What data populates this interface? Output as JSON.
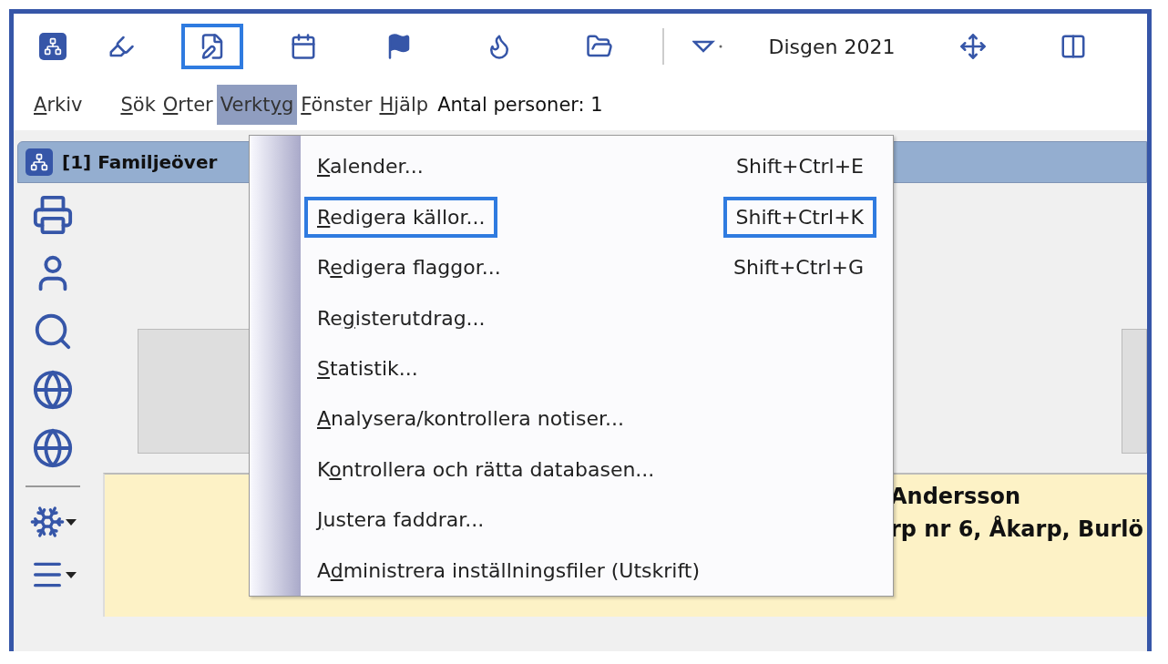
{
  "toolbar": {
    "items": [
      {
        "kind": "logo"
      },
      {
        "kind": "highlighter"
      },
      {
        "kind": "edit-document",
        "highlighted": true
      },
      {
        "kind": "calendar"
      },
      {
        "kind": "flag"
      },
      {
        "kind": "flame"
      },
      {
        "kind": "folder-person"
      },
      {
        "kind": "separator"
      },
      {
        "kind": "dropdown"
      },
      {
        "kind": "title",
        "text": "Disgen 2021"
      },
      {
        "kind": "move"
      },
      {
        "kind": "columns"
      }
    ]
  },
  "menubar": {
    "items": [
      {
        "key": "A",
        "after": "rkiv",
        "selected": false
      },
      {
        "key": "S",
        "after": "ök",
        "selected": false
      },
      {
        "key": "O",
        "after": "rter",
        "selected": false
      },
      {
        "before": "Verkt",
        "key": "y",
        "after": "g",
        "selected": true
      },
      {
        "key": "F",
        "after": "önster",
        "selected": false
      },
      {
        "key": "H",
        "after": "jälp",
        "selected": false
      }
    ],
    "status": "Antal personer: 1"
  },
  "tab": {
    "title": "[1] Familjeöver"
  },
  "sidebar": {
    "items": [
      {
        "kind": "printer"
      },
      {
        "kind": "person"
      },
      {
        "kind": "search"
      },
      {
        "kind": "globe-share"
      },
      {
        "kind": "globe-book"
      },
      {
        "kind": "separator"
      },
      {
        "kind": "star-dropdown"
      },
      {
        "kind": "menu-dropdown"
      }
    ]
  },
  "panel": {
    "lines": [
      "Andersson",
      "rp nr 6, Åkarp, Burlö"
    ]
  },
  "dropdown_menu": {
    "items": [
      {
        "key": "K",
        "after": "alender...",
        "shortcut": "Shift+Ctrl+E"
      },
      {
        "key": "R",
        "after": "edigera källor...",
        "shortcut": "Shift+Ctrl+K",
        "label_highlighted": true,
        "shortcut_highlighted": true
      },
      {
        "before": "R",
        "key": "e",
        "after": "digera flaggor...",
        "shortcut": "Shift+Ctrl+G"
      },
      {
        "before": "Re",
        "key": "g",
        "after": "isterutdrag..."
      },
      {
        "key": "S",
        "after": "tatistik..."
      },
      {
        "key": "A",
        "after": "nalysera/kontrollera notiser..."
      },
      {
        "before": "K",
        "key": "o",
        "after": "ntrollera och rätta databasen..."
      },
      {
        "key": "J",
        "after": "ustera faddrar..."
      },
      {
        "before": "A",
        "key": "d",
        "after": "ministrera inställningsfiler (Utskrift)"
      }
    ]
  }
}
